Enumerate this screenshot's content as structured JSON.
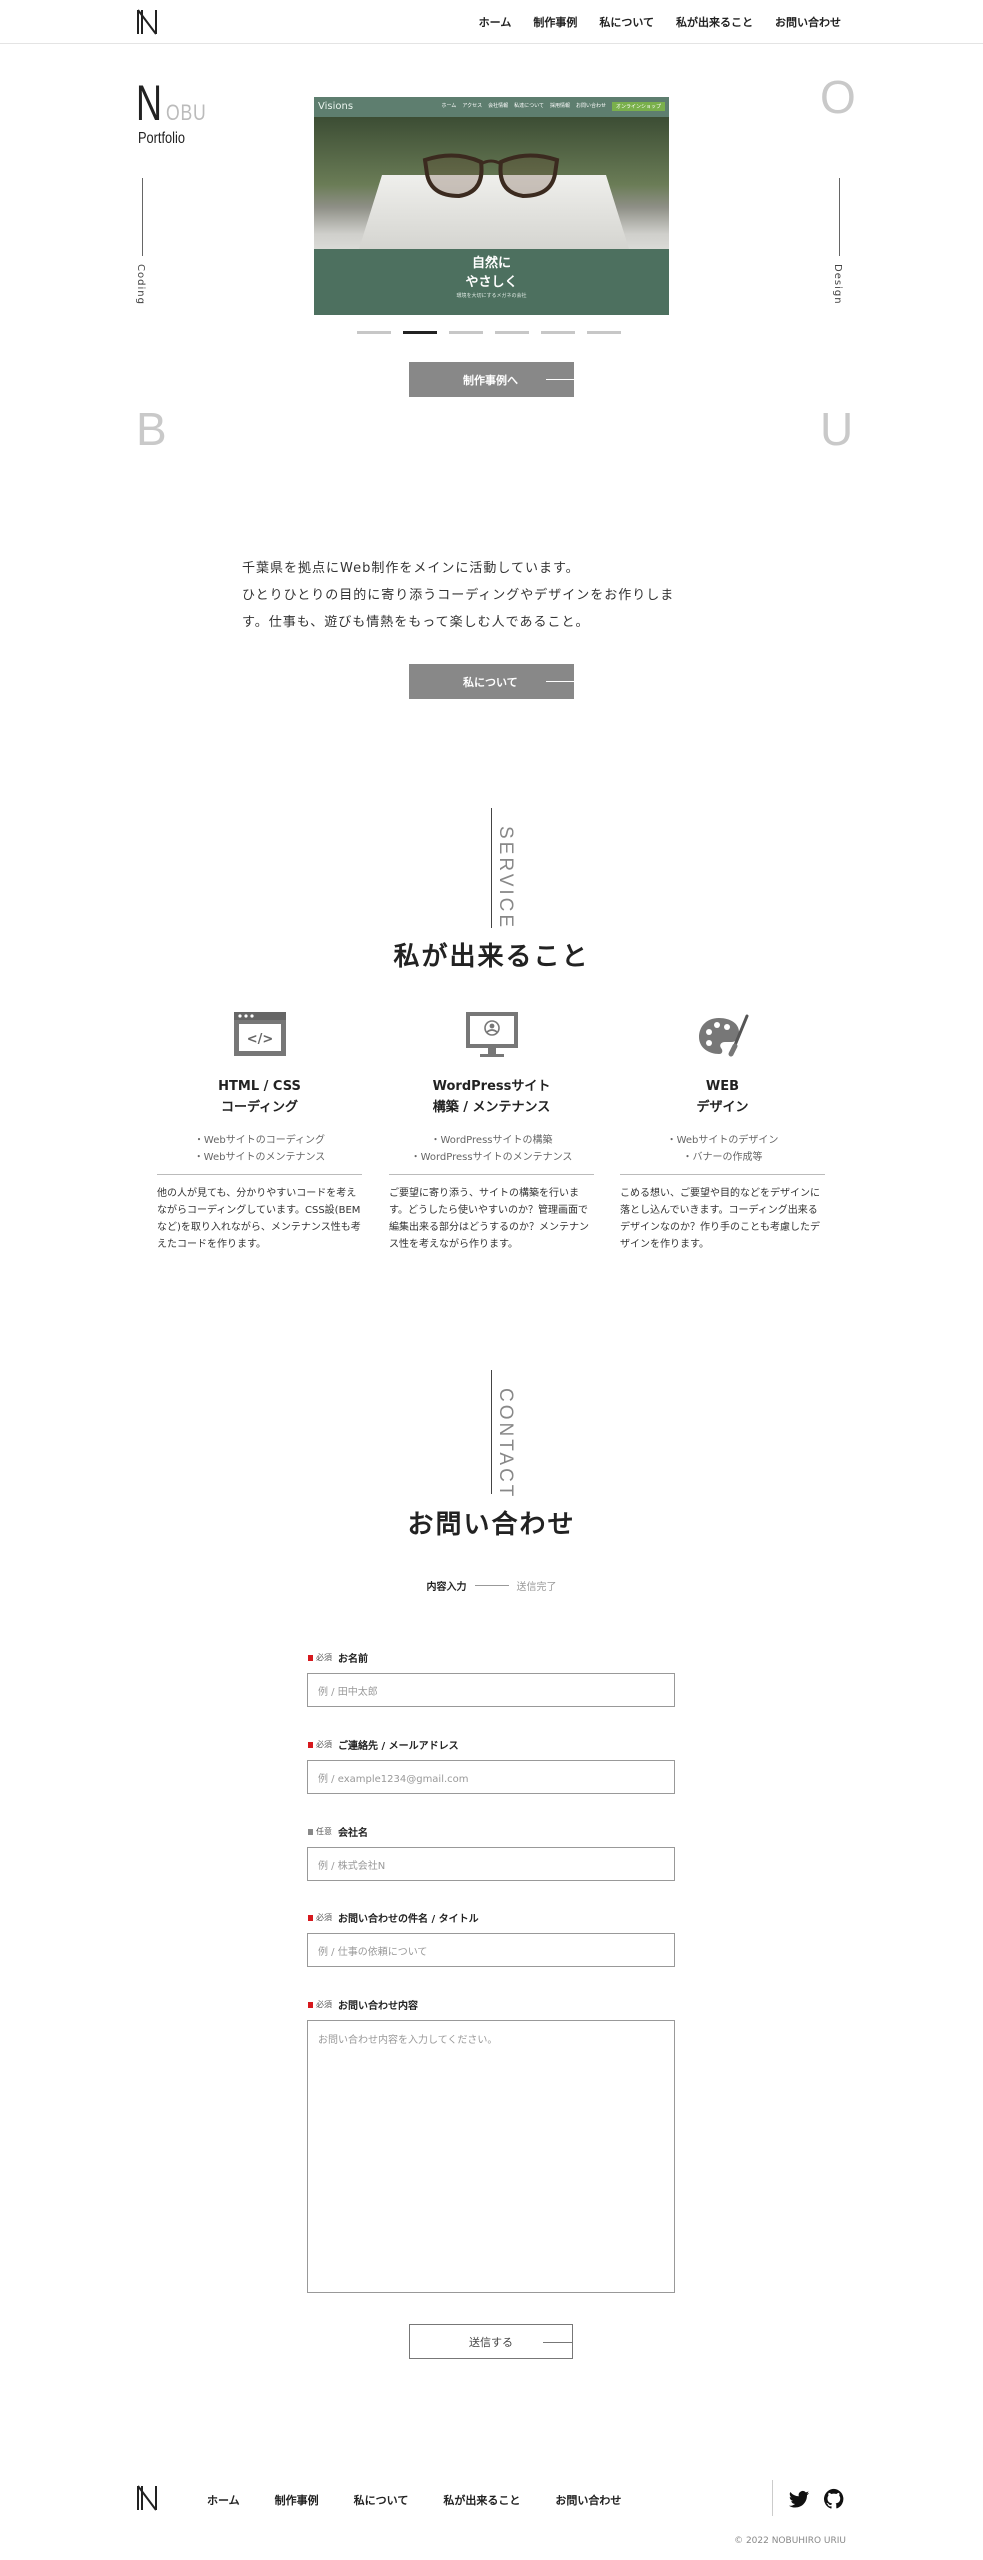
{
  "header": {
    "nav": [
      "ホーム",
      "制作事例",
      "私について",
      "私が出来ること",
      "お問い合わせ"
    ]
  },
  "hero": {
    "logo_big": "N",
    "logo_rest": "OBU",
    "subtitle": "Portfolio",
    "left_vertical": "Coding",
    "right_vertical": "Design",
    "letter_o": "O",
    "letter_b": "B",
    "letter_u": "U",
    "slide": {
      "brand": "Visions",
      "nav": [
        "ホーム",
        "アクセス",
        "会社情報",
        "私達について",
        "採用情報",
        "お問い合わせ"
      ],
      "nav_button": "オンラインショップ",
      "title_line1": "自然に",
      "title_line2": "やさしく",
      "subtitle": "環境を大切にするメガネの会社"
    },
    "slide_count": 6,
    "active_slide": 2,
    "works_button": "制作事例へ"
  },
  "about": {
    "lines": [
      "千葉県を拠点にWeb制作をメインに活動しています。",
      "ひとりひとりの目的に寄り添うコーディングやデザインをお作りしま",
      "す。仕事も、遊びも情熱をもって楽しむ人であること。"
    ],
    "button": "私について"
  },
  "service": {
    "label": "SERVICE",
    "title": "私が出来ること",
    "items": [
      {
        "icon": "code-window-icon",
        "name1": "HTML / CSS",
        "name2": "コーディング",
        "list1": "・Webサイトのコーディング",
        "list2": "・Webサイトのメンテナンス",
        "desc": "他の人が見ても、分かりやすいコードを考えながらコーディングしています。CSS設(BEMなど)を取り入れながら、メンテナンス性も考えたコードを作ります。"
      },
      {
        "icon": "monitor-icon",
        "name1": "WordPressサイト",
        "name2": "構築 / メンテナンス",
        "list1": "・WordPressサイトの構築",
        "list2": "・WordPressサイトのメンテナンス",
        "desc": "ご要望に寄り添う、サイトの構築を行います。どうしたら使いやすいのか？管理画面で編集出来る部分はどうするのか？メンテナンス性を考えながら作ります。"
      },
      {
        "icon": "palette-icon",
        "name1": "WEB",
        "name2": "デザイン",
        "list1": "・Webサイトのデザイン",
        "list2": "・バナーの作成等",
        "desc": "こめる想い、ご要望や目的などをデザインに落とし込んでいきます。コーディング出来るデザインなのか？作り手のことも考慮したデザインを作ります。"
      }
    ]
  },
  "contact": {
    "label": "CONTACT",
    "title": "お問い合わせ",
    "step_current": "内容入力",
    "step_next": "送信完了",
    "required": "必須",
    "optional": "任意",
    "fields": [
      {
        "label": "お名前",
        "placeholder": "例 / 田中太郎",
        "required": true
      },
      {
        "label": "ご連絡先 / メールアドレス",
        "placeholder": "例 / example1234@gmail.com",
        "required": true
      },
      {
        "label": "会社名",
        "placeholder": "例 / 株式会社N",
        "required": false
      },
      {
        "label": "お問い合わせの件名 / タイトル",
        "placeholder": "例 / 仕事の依頼について",
        "required": true
      },
      {
        "label": "お問い合わせ内容",
        "placeholder": "お問い合わせ内容を入力してください。",
        "required": true
      }
    ],
    "submit": "送信する"
  },
  "footer": {
    "nav": [
      "ホーム",
      "制作事例",
      "私について",
      "私が出来ること",
      "お問い合わせ"
    ],
    "social": [
      "twitter-icon",
      "github-icon"
    ],
    "copyright": "© 2022 NOBUHIRO URIU"
  },
  "colors": {
    "required": "#d6191e",
    "button": "#888888",
    "slide_green": "#4d705f"
  }
}
